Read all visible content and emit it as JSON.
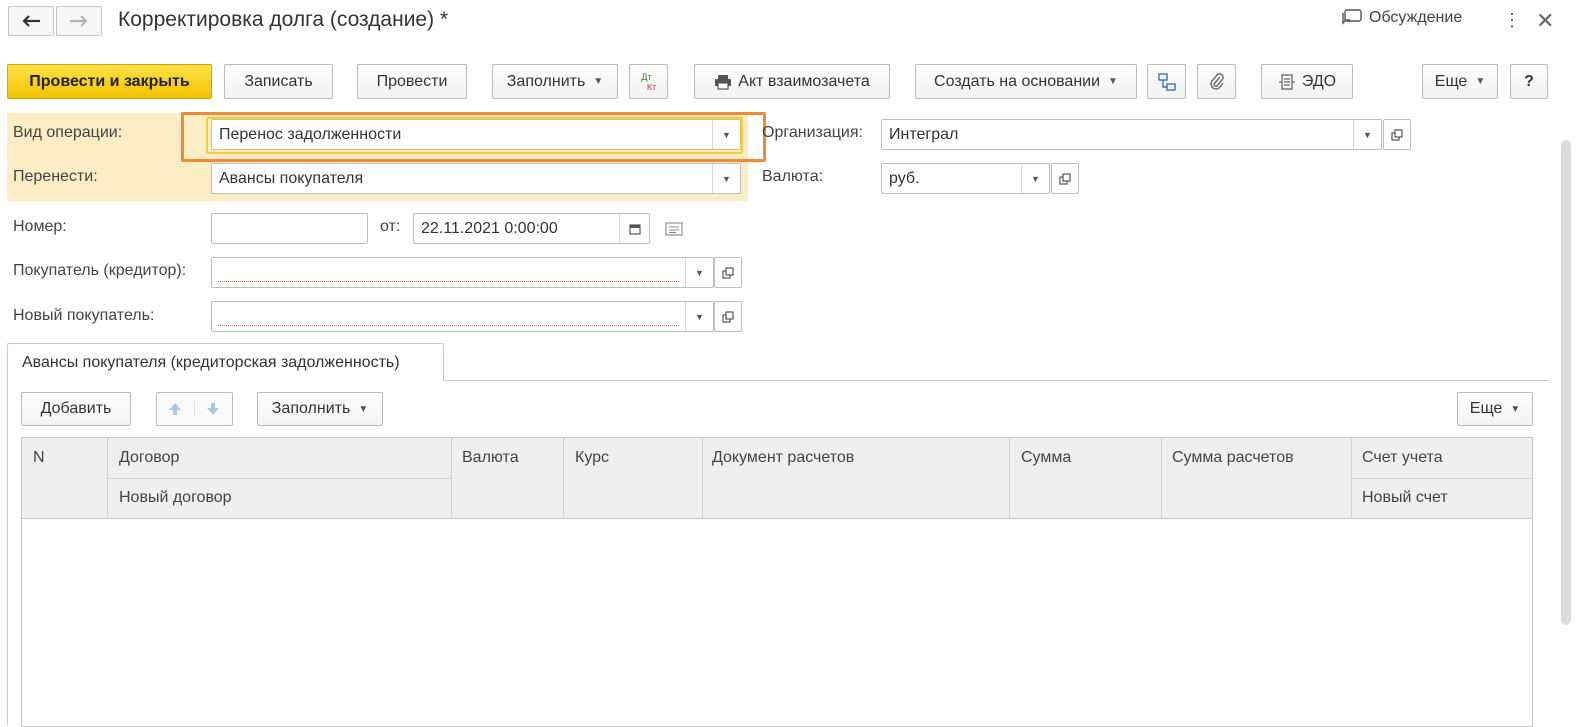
{
  "window": {
    "title": "Корректировка долга (создание) *",
    "discussion_label": "Обсуждение"
  },
  "toolbar": {
    "post_close": "Провести и закрыть",
    "save": "Записать",
    "post": "Провести",
    "fill": "Заполнить",
    "dtkt_top": "Дт",
    "dtkt_bottom": "Кт",
    "offset_act": "Акт взаимозачета",
    "create_based": "Создать на основании",
    "edo": "ЭДО",
    "more": "Еще",
    "help": "?"
  },
  "form": {
    "operation_label": "Вид операции:",
    "operation_value": "Перенос задолженности",
    "transfer_label": "Перенести:",
    "transfer_value": "Авансы покупателя",
    "organization_label": "Организация:",
    "organization_value": "Интеграл",
    "currency_label": "Валюта:",
    "currency_value": "руб.",
    "number_label": "Номер:",
    "number_value": "",
    "date_from_label": "от:",
    "date_value": "22.11.2021  0:00:00",
    "buyer_label": "Покупатель (кредитор):",
    "buyer_value": "",
    "new_buyer_label": "Новый покупатель:",
    "new_buyer_value": ""
  },
  "tabs": [
    {
      "label": "Авансы покупателя (кредиторская задолженность)",
      "active": true
    }
  ],
  "table_toolbar": {
    "add": "Добавить",
    "fill": "Заполнить",
    "more": "Еще"
  },
  "table": {
    "columns": {
      "n": "N",
      "contract": "Договор",
      "new_contract": "Новый договор",
      "currency": "Валюта",
      "rate": "Курс",
      "settlement_doc": "Документ расчетов",
      "amount": "Сумма",
      "settlement_amount": "Сумма расчетов",
      "account": "Счет учета",
      "new_account": "Новый счет"
    },
    "rows": []
  },
  "colors": {
    "primary_button": "#f5cd1c",
    "highlight_orange": "#ef8a37",
    "highlight_yellow": "#f4cb45",
    "header_bg": "#fcedc4"
  }
}
